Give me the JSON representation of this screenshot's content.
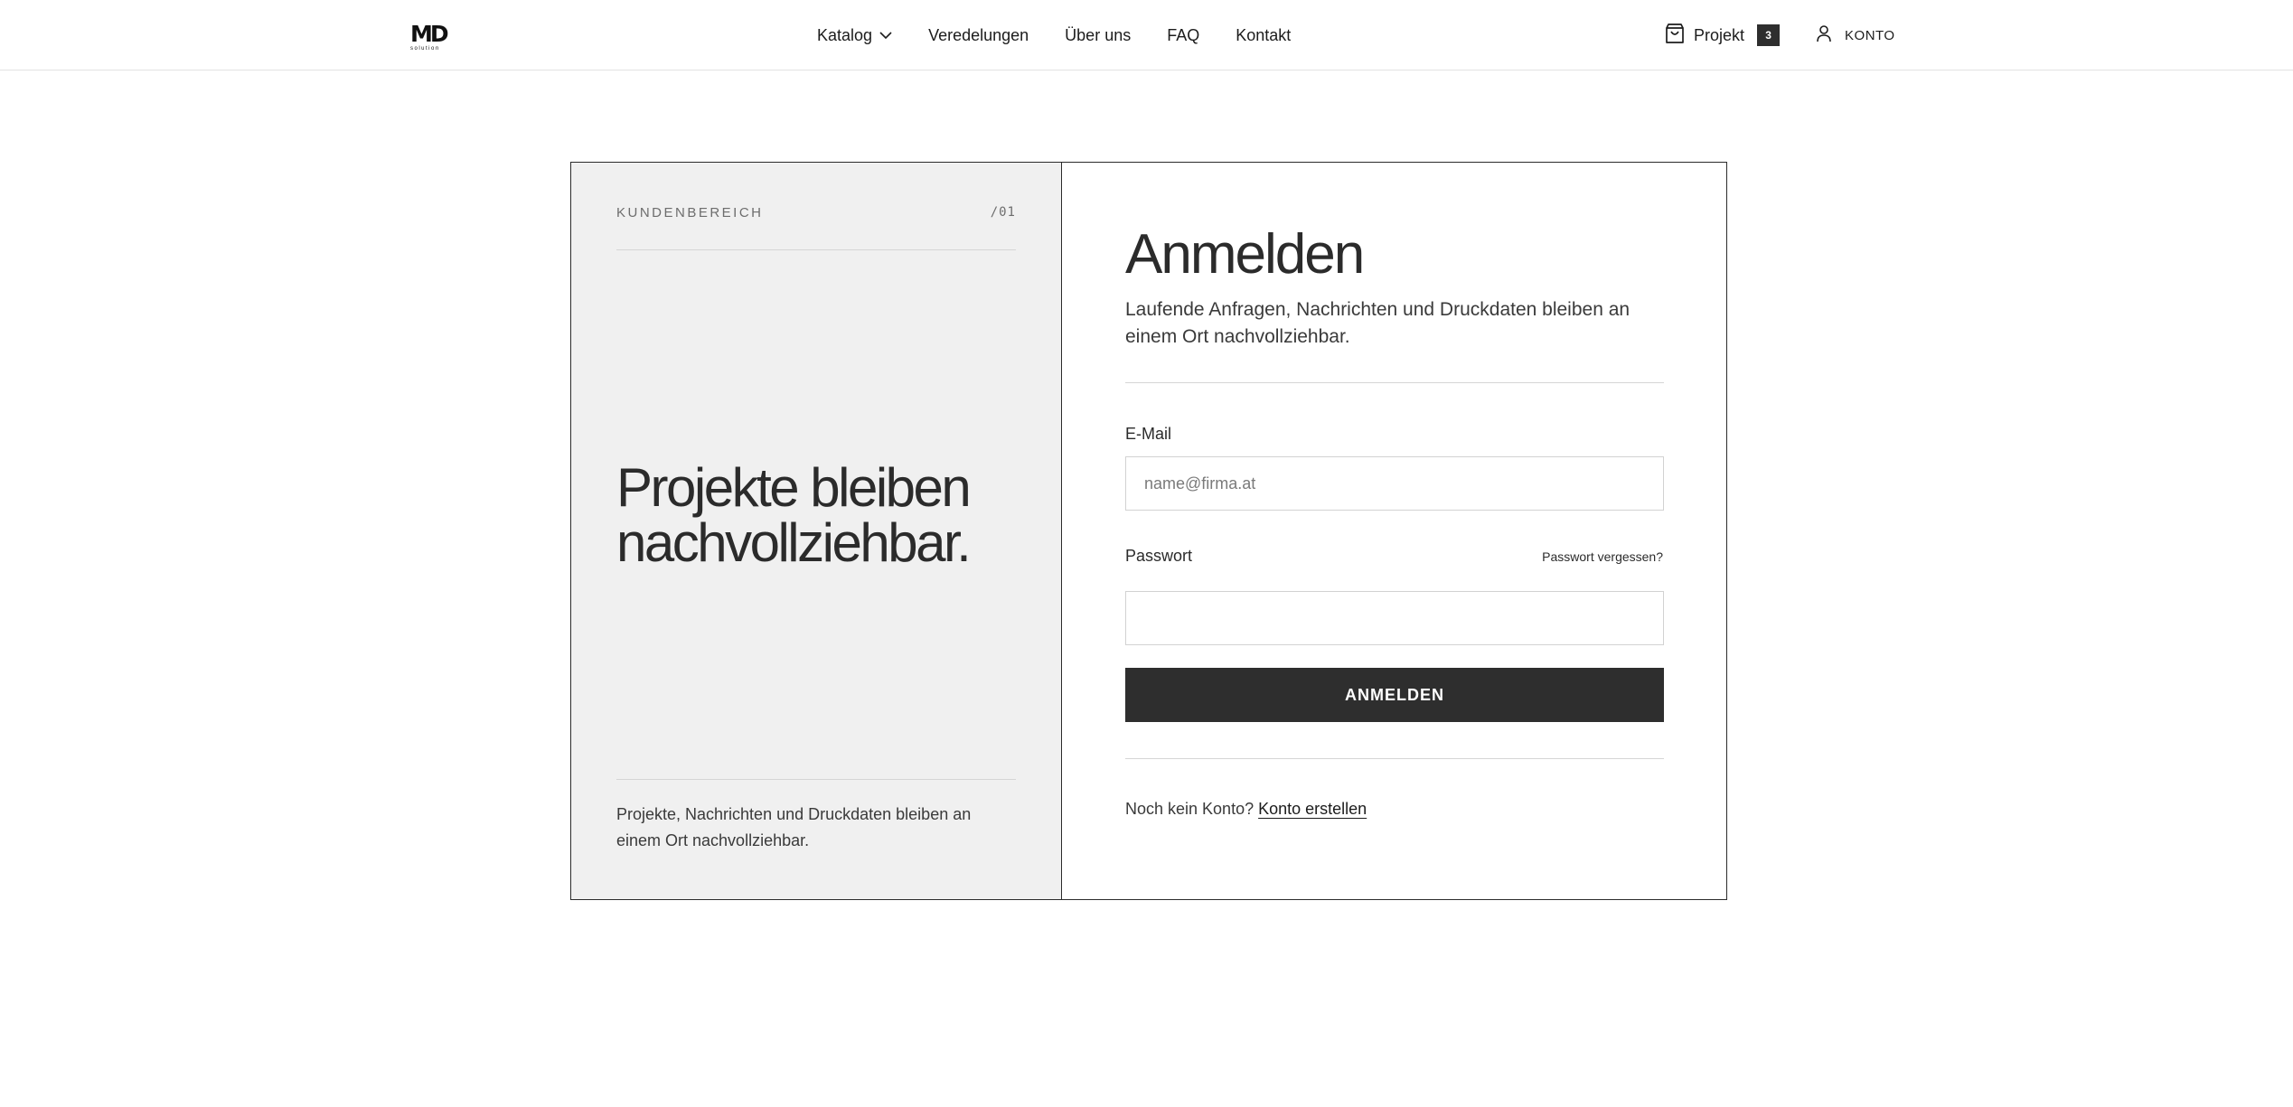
{
  "brand": {
    "logo_text": "MD",
    "logo_sub": "solution"
  },
  "nav": {
    "items": [
      {
        "label": "Katalog",
        "icon": "chevron-down-icon"
      },
      {
        "label": "Veredelungen"
      },
      {
        "label": "Über uns"
      },
      {
        "label": "FAQ"
      },
      {
        "label": "Kontakt"
      }
    ]
  },
  "header_right": {
    "project_label": "Projekt",
    "project_icon": "shopping-bag-icon",
    "project_count": "3",
    "account_label": "KONTO",
    "account_icon": "user-icon"
  },
  "left_panel": {
    "eyebrow": "KUNDENBEREICH",
    "step": "/01",
    "heading_line1": "Projekte bleiben",
    "heading_line2": "nachvollziehbar.",
    "footnote": "Projekte, Nachrichten und Druckdaten bleiben an einem Ort nachvollziehbar."
  },
  "login": {
    "title": "Anmelden",
    "subtitle": "Laufende Anfragen, Nachrichten und Druckdaten bleiben an einem Ort nachvollziehbar.",
    "email_label": "E-Mail",
    "email_placeholder": "name@firma.at",
    "email_value": "",
    "password_label": "Passwort",
    "forgot_label": "Passwort vergessen?",
    "password_value": "",
    "submit_label": "ANMELDEN",
    "register_prompt": "Noch kein Konto?",
    "register_link": "Konto erstellen"
  },
  "colors": {
    "text": "#2b2b2b",
    "button_bg": "#2e2e2e",
    "left_panel_bg": "#f0f0f0",
    "border": "#2b2b2b"
  }
}
